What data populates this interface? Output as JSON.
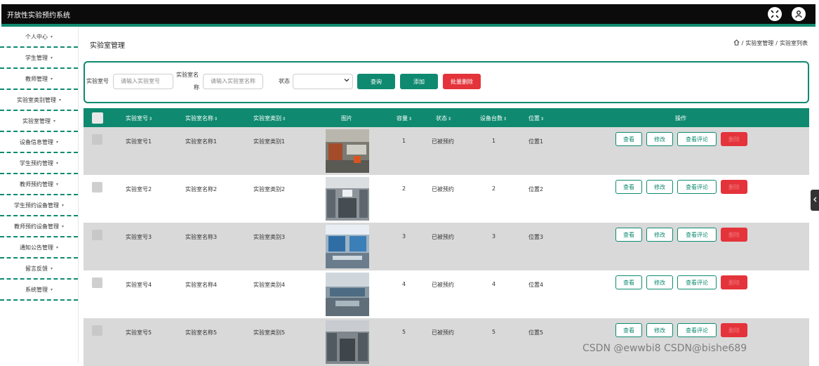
{
  "app": {
    "title": "开放性实验预约系统"
  },
  "sidebar": {
    "items": [
      {
        "label": "个人中心"
      },
      {
        "label": "学生管理"
      },
      {
        "label": "教师管理"
      },
      {
        "label": "实验室类别管理"
      },
      {
        "label": "实验室管理"
      },
      {
        "label": "设备信息管理"
      },
      {
        "label": "学生预约管理"
      },
      {
        "label": "教师预约管理"
      },
      {
        "label": "学生预约设备管理"
      },
      {
        "label": "教师预约设备管理"
      },
      {
        "label": "通知公告管理"
      },
      {
        "label": "留言反馈"
      },
      {
        "label": "系统管理"
      }
    ],
    "caret": "▾"
  },
  "page": {
    "title": "实验室管理",
    "breadcrumb": {
      "home_icon": "home-icon",
      "sep": "/",
      "level1": "实验室管理",
      "level2": "实验室列表"
    }
  },
  "search": {
    "lab_no_label": "实验室号",
    "lab_no_placeholder": "请输入实验室号",
    "lab_name_label_1": "实验室名",
    "lab_name_label_2": "称",
    "lab_name_placeholder": "请输入实验室名称",
    "status_label": "状态",
    "status_value": "",
    "query_button": "查询",
    "add_button": "添加",
    "batch_delete_button": "批量删除"
  },
  "table": {
    "columns": [
      "实验室号",
      "实验室名称",
      "实验室类别",
      "图片",
      "容量",
      "状态",
      "设备台数",
      "位置",
      "操作"
    ],
    "sort_glyph": "⇕",
    "rows": [
      {
        "lab_no": "实验室号1",
        "lab_name": "实验室名称1",
        "category": "实验室类别1",
        "capacity": "1",
        "status": "已被预约",
        "devices": "1",
        "location": "位置1"
      },
      {
        "lab_no": "实验室号2",
        "lab_name": "实验室名称2",
        "category": "实验室类别2",
        "capacity": "2",
        "status": "已被预约",
        "devices": "2",
        "location": "位置2"
      },
      {
        "lab_no": "实验室号3",
        "lab_name": "实验室名称3",
        "category": "实验室类别3",
        "capacity": "3",
        "status": "已被预约",
        "devices": "3",
        "location": "位置3"
      },
      {
        "lab_no": "实验室号4",
        "lab_name": "实验室名称4",
        "category": "实验室类别4",
        "capacity": "4",
        "status": "已被预约",
        "devices": "4",
        "location": "位置4"
      },
      {
        "lab_no": "实验室号5",
        "lab_name": "实验室名称5",
        "category": "实验室类别5",
        "capacity": "5",
        "status": "已被预约",
        "devices": "5",
        "location": "位置5"
      }
    ],
    "actions": {
      "view": "查看",
      "edit": "修改",
      "view_comments": "查看评论",
      "delete": "删除"
    }
  },
  "colors": {
    "accent": "#0f8a70",
    "danger": "#e4333a",
    "topbar": "#0b0b0b"
  },
  "watermark": "CSDN @ewwbi8  CSDN@bishe689"
}
